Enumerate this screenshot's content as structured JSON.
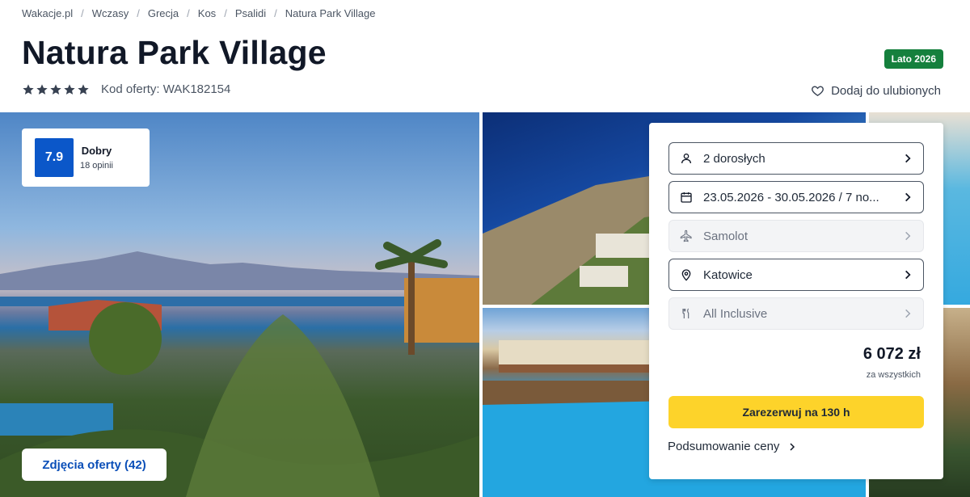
{
  "breadcrumb": [
    "Wakacje.pl",
    "Wczasy",
    "Grecja",
    "Kos",
    "Psalidi",
    "Natura Park Village"
  ],
  "hotel": {
    "name": "Natura Park Village",
    "season_badge": "Lato 2026",
    "stars": 5,
    "offer_code": "Kod oferty: WAK182154",
    "favorite_label": "Dodaj do ulubionych"
  },
  "review": {
    "score": "7.9",
    "label": "Dobry",
    "count": "18 opinii"
  },
  "gallery": {
    "photos_button": "Zdjęcia oferty (42)"
  },
  "booking": {
    "travelers": "2 dorosłych",
    "dates": "23.05.2026 - 30.05.2026 / 7 no...",
    "transport": "Samolot",
    "departure": "Katowice",
    "board": "All Inclusive",
    "price": "6 072 zł",
    "price_note": "za wszystkich",
    "book_button": "Zarezerwuj na 130 h",
    "summary_link": "Podsumowanie ceny"
  },
  "colors": {
    "season_badge": "#15803d",
    "score_box": "#0b57c9",
    "book_button": "#fdd32a",
    "photos_button_text": "#0b4fb8"
  },
  "icons": [
    "star-icon",
    "heart-icon",
    "person-icon",
    "calendar-icon",
    "plane-icon",
    "location-pin-icon",
    "cutlery-icon",
    "chevron-right-icon"
  ]
}
